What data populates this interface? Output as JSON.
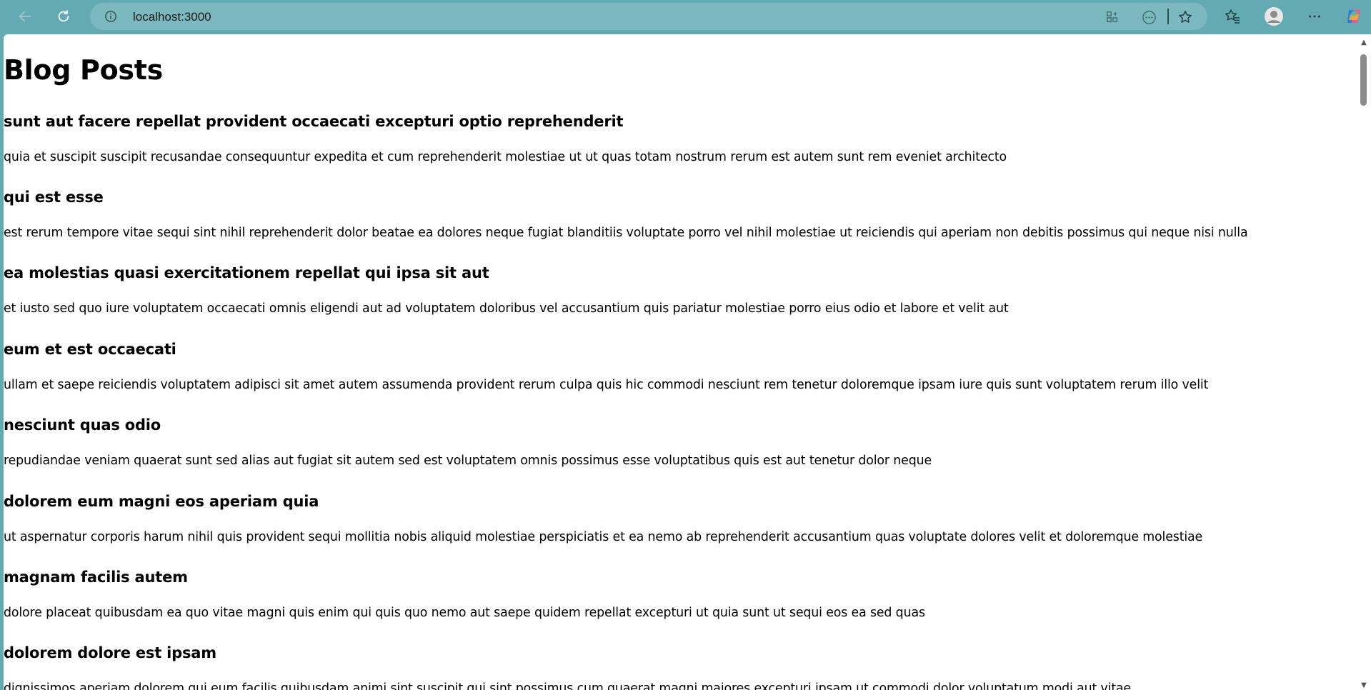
{
  "browser": {
    "address": "localhost:3000",
    "icons": {
      "back": "back-arrow-icon",
      "refresh": "refresh-icon",
      "info": "info-icon",
      "app_grid": "app-grid-icon",
      "more_circle": "more-circle-icon",
      "favorite": "star-icon",
      "favorites": "favorites-list-icon",
      "profile": "profile-avatar-icon",
      "menu": "ellipsis-menu-icon",
      "copilot": "copilot-icon"
    },
    "accent": "#63aab2"
  },
  "page": {
    "title": "Blog Posts",
    "posts": [
      {
        "title": "sunt aut facere repellat provident occaecati excepturi optio reprehenderit",
        "body": "quia et suscipit suscipit recusandae consequuntur expedita et cum reprehenderit molestiae ut ut quas totam nostrum rerum est autem sunt rem eveniet architecto"
      },
      {
        "title": "qui est esse",
        "body": "est rerum tempore vitae sequi sint nihil reprehenderit dolor beatae ea dolores neque fugiat blanditiis voluptate porro vel nihil molestiae ut reiciendis qui aperiam non debitis possimus qui neque nisi nulla"
      },
      {
        "title": "ea molestias quasi exercitationem repellat qui ipsa sit aut",
        "body": "et iusto sed quo iure voluptatem occaecati omnis eligendi aut ad voluptatem doloribus vel accusantium quis pariatur molestiae porro eius odio et labore et velit aut"
      },
      {
        "title": "eum et est occaecati",
        "body": "ullam et saepe reiciendis voluptatem adipisci sit amet autem assumenda provident rerum culpa quis hic commodi nesciunt rem tenetur doloremque ipsam iure quis sunt voluptatem rerum illo velit"
      },
      {
        "title": "nesciunt quas odio",
        "body": "repudiandae veniam quaerat sunt sed alias aut fugiat sit autem sed est voluptatem omnis possimus esse voluptatibus quis est aut tenetur dolor neque"
      },
      {
        "title": "dolorem eum magni eos aperiam quia",
        "body": "ut aspernatur corporis harum nihil quis provident sequi mollitia nobis aliquid molestiae perspiciatis et ea nemo ab reprehenderit accusantium quas voluptate dolores velit et doloremque molestiae"
      },
      {
        "title": "magnam facilis autem",
        "body": "dolore placeat quibusdam ea quo vitae magni quis enim qui quis quo nemo aut saepe quidem repellat excepturi ut quia sunt ut sequi eos ea sed quas"
      },
      {
        "title": "dolorem dolore est ipsam",
        "body": "dignissimos aperiam dolorem qui eum facilis quibusdam animi sint suscipit qui sint possimus cum quaerat magni maiores excepturi ipsam ut commodi dolor voluptatum modi aut vitae"
      }
    ]
  }
}
